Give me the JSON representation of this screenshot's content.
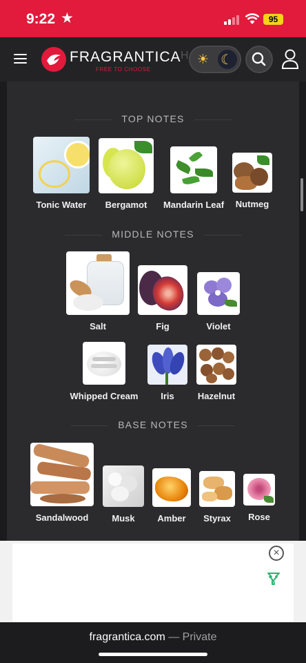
{
  "status_bar": {
    "time": "9:22",
    "battery": "95",
    "star_icon": "star-icon"
  },
  "nav": {
    "logo_text": "FRAGRANTICA",
    "logo_tagline": "FREE TO CHOOSE",
    "hint": "H",
    "icons": [
      "menu-icon",
      "sun-icon",
      "moon-icon",
      "search-icon",
      "user-icon"
    ]
  },
  "sections": {
    "top": "TOP NOTES",
    "middle": "MIDDLE NOTES",
    "base": "BASE NOTES"
  },
  "top_notes": [
    "Tonic Water",
    "Bergamot",
    "Mandarin Leaf",
    "Nutmeg"
  ],
  "middle_notes": [
    "Salt",
    "Fig",
    "Violet",
    "Whipped Cream",
    "Iris",
    "Hazelnut"
  ],
  "base_notes": [
    "Sandalwood",
    "Musk",
    "Amber",
    "Styrax",
    "Rose"
  ],
  "ad": {
    "close": "×"
  },
  "browser": {
    "domain": "fragrantica.com",
    "separator": " — ",
    "mode": "Private"
  },
  "colors": {
    "brand": "#e21a3c",
    "battery": "#f6d21b"
  }
}
